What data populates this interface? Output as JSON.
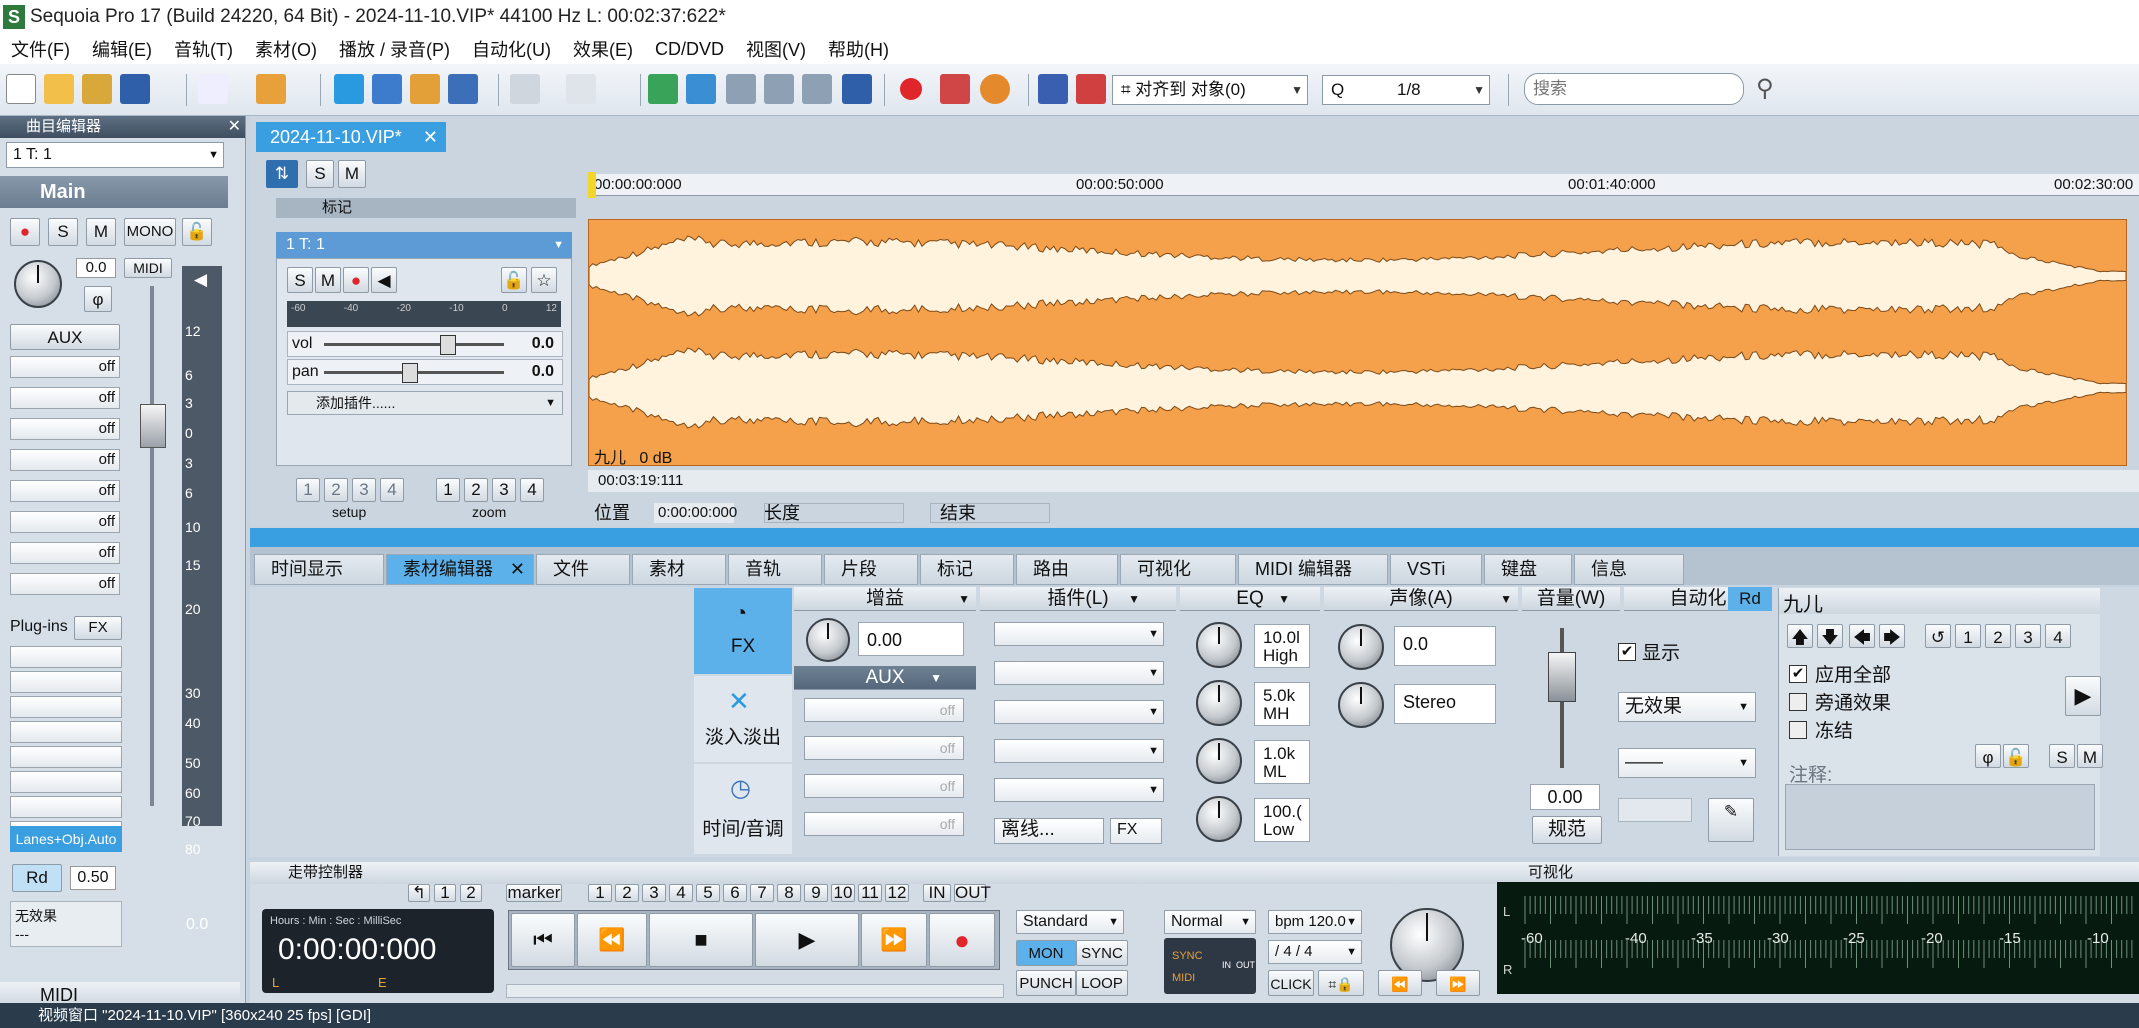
{
  "window": {
    "title": "Sequoia Pro 17 (Build 24220, 64 Bit)  -  2024-11-10.VIP*   44100 Hz L: 00:02:37:622*"
  },
  "menu": [
    "文件(F)",
    "编辑(E)",
    "音轨(T)",
    "素材(O)",
    "播放 / 录音(P)",
    "自动化(U)",
    "效果(E)",
    "CD/DVD",
    "视图(V)",
    "帮助(H)"
  ],
  "toolbar": {
    "snap_label": "对齐到  对象(0)",
    "quant_label": "Q",
    "quant_value": "1/8",
    "search_placeholder": "搜索"
  },
  "track_editor": {
    "header": "曲目编辑器",
    "track_select": "1  T: 1",
    "main_label": "Main",
    "mono": "MONO",
    "midi_small": "MIDI",
    "pan_value": "0.0",
    "aux": "AUX",
    "aux_slots": [
      "off",
      "off",
      "off",
      "off",
      "off",
      "off",
      "off",
      "off"
    ],
    "plugins_label": "Plug-ins",
    "fx": "FX",
    "lanes": "Lanes+Obj.Auto",
    "rd": "Rd",
    "rd_value": "0.50",
    "no_effect": "无效果",
    "no_effect_sub": "---",
    "fader_value": "0.0",
    "scale": [
      "12",
      "6",
      "3",
      "0",
      "3",
      "6",
      "10",
      "15",
      "20",
      "30",
      "40",
      "50",
      "60",
      "70",
      "80"
    ],
    "midi_section": "MIDI"
  },
  "project_tab": "2024-11-10.VIP*",
  "track": {
    "markers_label": "标记",
    "name": "1    T: 1",
    "vol_label": "vol",
    "vol_value": "0.0",
    "pan_label": "pan",
    "pan_value": "0.0",
    "add_plugin": "添加插件......",
    "meter_ticks": [
      "-60",
      "-40",
      "-20",
      "-10",
      "0",
      "12"
    ],
    "setup_label": "setup",
    "zoom_label": "zoom",
    "nums": [
      "1",
      "2",
      "3",
      "4"
    ]
  },
  "timeline": {
    "marks": [
      "00:00:00:000",
      "00:00:50:000",
      "00:01:40:000",
      "00:02:30:00"
    ],
    "cursor_time": "00:03:19:111"
  },
  "clip": {
    "name": "九儿",
    "gain": "0 dB"
  },
  "positionbar": {
    "pos_label": "位置",
    "pos_value": "0:00:00:000",
    "len_label": "长度",
    "end_label": "结束"
  },
  "tabs": [
    "时间显示",
    "素材编辑器",
    "文件",
    "素材",
    "音轨",
    "片段",
    "标记",
    "路由",
    "可视化",
    "MIDI 编辑器",
    "VSTi",
    "键盘",
    "信息"
  ],
  "clip_editor": {
    "fx": "FX",
    "fade": "淡入淡出",
    "time_pitch": "时间/音调",
    "gain_title": "增益",
    "gain_value": "0.00",
    "aux_title": "AUX",
    "aux_slots": [
      "off",
      "off",
      "off",
      "off"
    ],
    "plugin_title": "插件(L)",
    "offline": "离线...",
    "fx_small": "FX",
    "eq_title": "EQ",
    "eq_bands": [
      {
        "v": "10.0l",
        "n": "High"
      },
      {
        "v": "5.0k",
        "n": "MH"
      },
      {
        "v": "1.0k",
        "n": "ML"
      },
      {
        "v": "100.(",
        "n": "Low"
      }
    ],
    "pan_title": "声像(A)",
    "pan_value": "0.0",
    "stereo": "Stereo",
    "vol_title": "音量(W)",
    "vol_value": "0.00",
    "normalize": "规范",
    "auto_title": "自动化",
    "auto_rd": "Rd",
    "show": "显示",
    "auto_effect": "无效果",
    "auto_curve": "——",
    "info_title": "九儿",
    "apply_all": "应用全部",
    "bypass": "旁通效果",
    "freeze": "冻结",
    "nums": [
      "1",
      "2",
      "3",
      "4"
    ],
    "comment": "注释:"
  },
  "transport": {
    "title": "走带控制器",
    "marker": "marker",
    "marker_nums": [
      "1",
      "2",
      "3",
      "4",
      "5",
      "6",
      "7",
      "8",
      "9",
      "10",
      "11",
      "12"
    ],
    "inout": [
      "IN",
      "OUT"
    ],
    "top_nums": [
      "1",
      "2"
    ],
    "time_format": "Hours : Min : Sec : MilliSec",
    "time_value": "0:00:00:000",
    "mode": "Standard",
    "mon": "MON",
    "sync": "SYNC",
    "punch": "PUNCH",
    "loop": "LOOP",
    "normal": "Normal",
    "bpm": "bpm  120.0",
    "sig": "/   4 / 4",
    "click": "CLICK",
    "sync_badge": "SYNC",
    "midi_badge": "MIDI",
    "in": "IN",
    "out": "OUT"
  },
  "visualization": {
    "title": "可视化",
    "ticks": [
      "-60",
      "-40",
      "-35",
      "-30",
      "-25",
      "-20",
      "-15",
      "-10"
    ],
    "l": "L",
    "r": "R"
  },
  "status": {
    "text": "视频窗口 \"2024-11-10.VIP\"  [360x240 25 fps] [GDI]"
  },
  "colors": {
    "wave_bg": "#f5a04a",
    "wave_fg": "#fff3dd",
    "accent": "#3a9fe0",
    "record": "#e0262b"
  }
}
